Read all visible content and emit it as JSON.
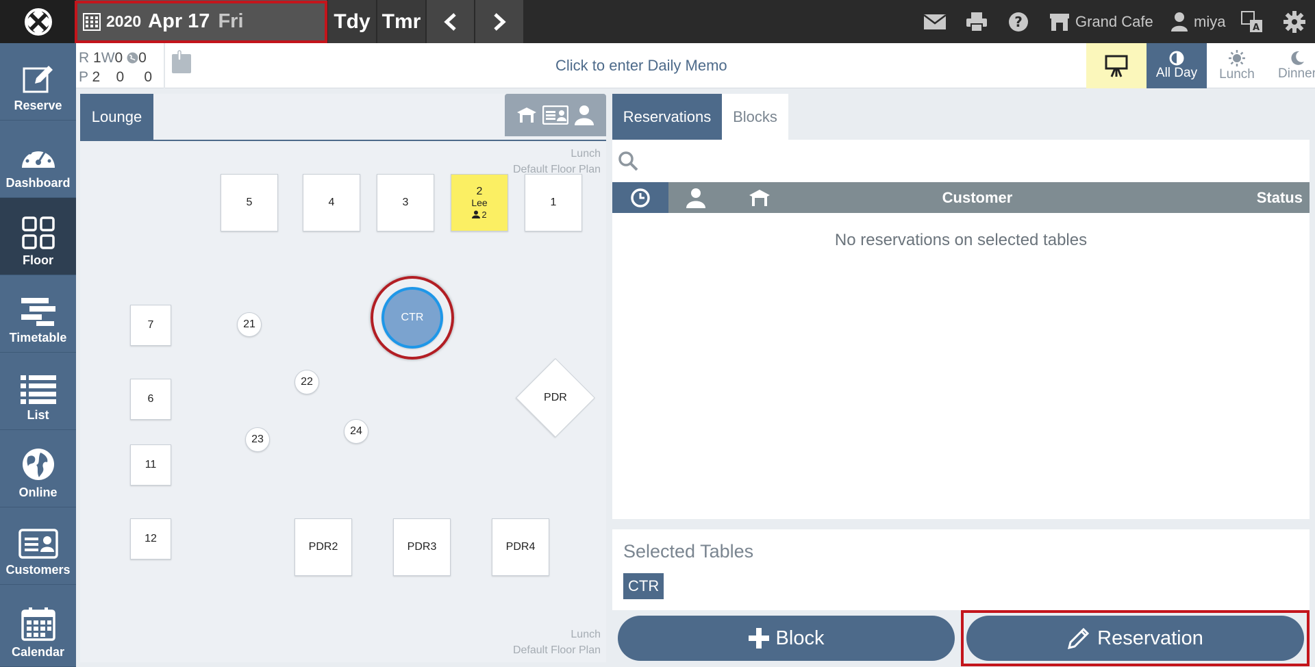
{
  "topbar": {
    "date": {
      "year": "2020",
      "month_day": "Apr 17",
      "weekday": "Fri"
    },
    "today_label": "Tdy",
    "tomorrow_label": "Tmr",
    "restaurant_name": "Grand Cafe",
    "user_name": "miya"
  },
  "sidebar": {
    "items": [
      {
        "label": "Reserve",
        "icon": "edit-icon"
      },
      {
        "label": "Dashboard",
        "icon": "gauge-icon"
      },
      {
        "label": "Floor",
        "icon": "grid-icon",
        "active": true
      },
      {
        "label": "Timetable",
        "icon": "timetable-icon"
      },
      {
        "label": "List",
        "icon": "list-icon"
      },
      {
        "label": "Online",
        "icon": "globe-icon"
      },
      {
        "label": "Customers",
        "icon": "id-card-icon"
      },
      {
        "label": "Calendar",
        "icon": "calendar-icon"
      }
    ]
  },
  "counts": {
    "r_label": "R",
    "r_value": "1",
    "w_label": "W",
    "w_value": "0",
    "o_value": "0",
    "p_label": "P",
    "p_value": "2",
    "p_w_value": "0",
    "p_o_value": "0"
  },
  "memo": {
    "placeholder": "Click to enter Daily Memo"
  },
  "modes": {
    "all_day": "All Day",
    "lunch": "Lunch",
    "dinner": "Dinner",
    "active": "All Day"
  },
  "floor": {
    "area_tab": "Lounge",
    "plan_note_top": [
      "Lunch",
      "Default Floor Plan"
    ],
    "plan_note_bottom": [
      "Lunch",
      "Default Floor Plan"
    ],
    "tables": {
      "t5": "5",
      "t4": "4",
      "t3": "3",
      "t1": "1",
      "t2": {
        "number": "2",
        "guest": "Lee",
        "party": "2"
      },
      "t7": "7",
      "t6": "6",
      "t11": "11",
      "t12": "12",
      "t21": "21",
      "t22": "22",
      "t23": "23",
      "t24": "24",
      "ctr": "CTR",
      "pdr": "PDR",
      "pdr2": "PDR2",
      "pdr3": "PDR3",
      "pdr4": "PDR4"
    }
  },
  "reservations": {
    "tabs": [
      "Reservations",
      "Blocks"
    ],
    "columns": {
      "customer": "Customer",
      "status": "Status"
    },
    "empty_message": "No reservations on selected tables"
  },
  "selected_tables": {
    "title": "Selected Tables",
    "items": [
      "CTR"
    ]
  },
  "actions": {
    "block": "Block",
    "reservation": "Reservation"
  },
  "colors": {
    "accent": "#4d6a8a",
    "highlight": "#c3151c",
    "occupied": "#fbef63",
    "selected_table": "#7ba3cf"
  }
}
